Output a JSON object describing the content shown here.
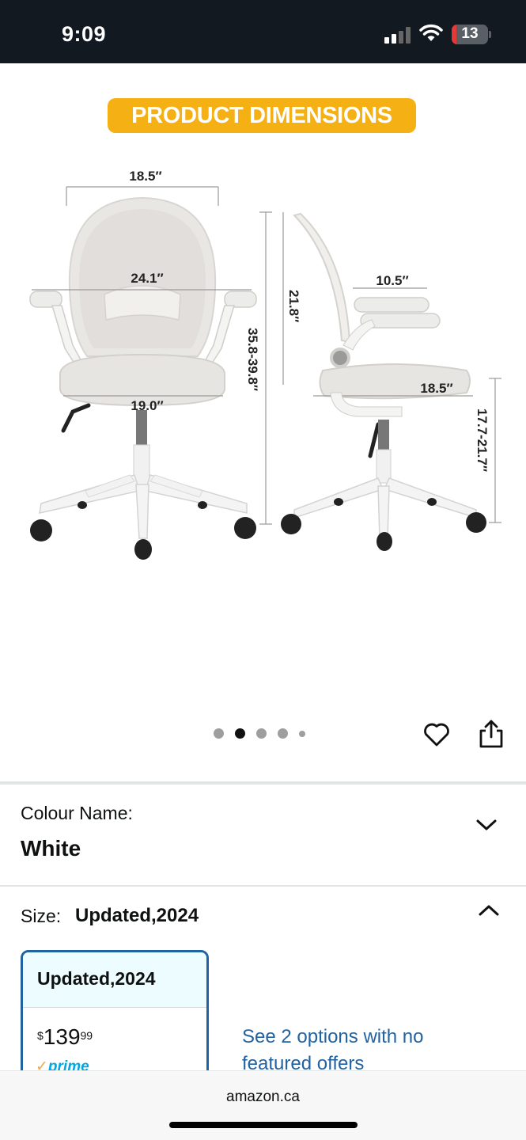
{
  "status_bar": {
    "time": "9:09",
    "battery_level": "13",
    "battery_fraction": 0.13
  },
  "product_image": {
    "badge": "PRODUCT DIMENSIONS",
    "dimensions": {
      "back_width": "18.5″",
      "arm_width": "24.1″",
      "seat_width": "19.0″",
      "total_height": "35.8-39.8″",
      "back_height": "21.8″",
      "armrest_length": "10.5″",
      "seat_depth": "18.5″",
      "seat_height": "17.7-21.7″"
    }
  },
  "carousel": {
    "dot_count": 5,
    "active_index": 1,
    "favorite_icon": "heart-icon",
    "share_icon": "share-icon"
  },
  "colour": {
    "label": "Colour Name:",
    "value": "White"
  },
  "size": {
    "label": "Size:",
    "value": "Updated,2024",
    "options": [
      {
        "title": "Updated,2024",
        "currency": "$",
        "price_whole": "139",
        "price_fraction": "99",
        "prime": "prime",
        "selected": true
      }
    ],
    "more_options_text": "See 2 options with no featured offers"
  },
  "browser": {
    "url": "amazon.ca"
  },
  "colors": {
    "accent_badge": "#f5b014",
    "link": "#2162a1",
    "status_bar": "#131921",
    "selected_border": "#2162a1"
  }
}
